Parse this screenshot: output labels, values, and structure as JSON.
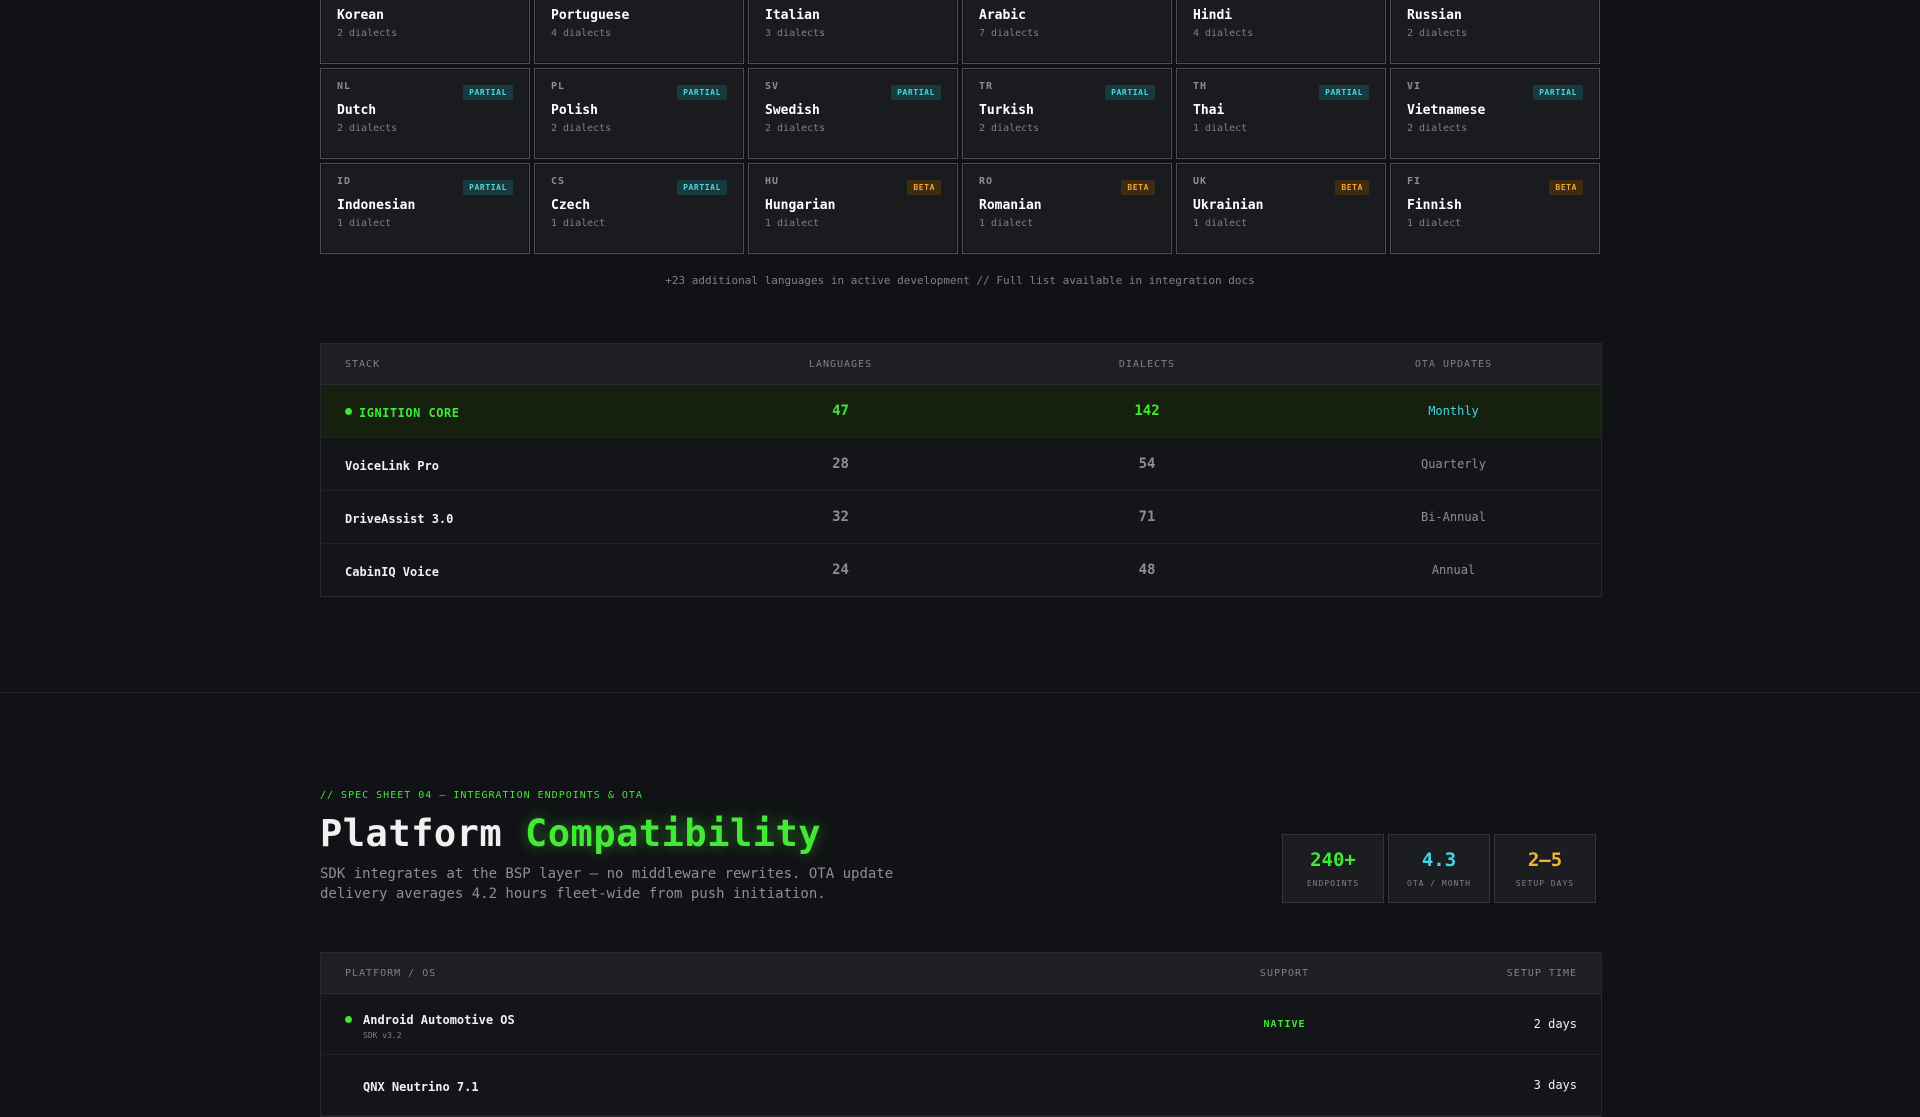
{
  "languages": [
    {
      "code": "",
      "name": "Korean",
      "dialects": "2 dialects",
      "status": "",
      "tier": "full"
    },
    {
      "code": "",
      "name": "Portuguese",
      "dialects": "4 dialects",
      "status": "",
      "tier": "full"
    },
    {
      "code": "",
      "name": "Italian",
      "dialects": "3 dialects",
      "status": "",
      "tier": "full"
    },
    {
      "code": "",
      "name": "Arabic",
      "dialects": "7 dialects",
      "status": "",
      "tier": "full"
    },
    {
      "code": "",
      "name": "Hindi",
      "dialects": "4 dialects",
      "status": "",
      "tier": "full"
    },
    {
      "code": "",
      "name": "Russian",
      "dialects": "2 dialects",
      "status": "",
      "tier": "full"
    },
    {
      "code": "NL",
      "name": "Dutch",
      "dialects": "2 dialects",
      "status": "PARTIAL",
      "tier": "partial"
    },
    {
      "code": "PL",
      "name": "Polish",
      "dialects": "2 dialects",
      "status": "PARTIAL",
      "tier": "partial"
    },
    {
      "code": "SV",
      "name": "Swedish",
      "dialects": "2 dialects",
      "status": "PARTIAL",
      "tier": "partial"
    },
    {
      "code": "TR",
      "name": "Turkish",
      "dialects": "2 dialects",
      "status": "PARTIAL",
      "tier": "partial"
    },
    {
      "code": "TH",
      "name": "Thai",
      "dialects": "1 dialect",
      "status": "PARTIAL",
      "tier": "partial"
    },
    {
      "code": "VI",
      "name": "Vietnamese",
      "dialects": "2 dialects",
      "status": "PARTIAL",
      "tier": "partial"
    },
    {
      "code": "ID",
      "name": "Indonesian",
      "dialects": "1 dialect",
      "status": "PARTIAL",
      "tier": "partial"
    },
    {
      "code": "CS",
      "name": "Czech",
      "dialects": "1 dialect",
      "status": "PARTIAL",
      "tier": "partial"
    },
    {
      "code": "HU",
      "name": "Hungarian",
      "dialects": "1 dialect",
      "status": "BETA",
      "tier": "beta"
    },
    {
      "code": "RO",
      "name": "Romanian",
      "dialects": "1 dialect",
      "status": "BETA",
      "tier": "beta"
    },
    {
      "code": "UK",
      "name": "Ukrainian",
      "dialects": "1 dialect",
      "status": "BETA",
      "tier": "beta"
    },
    {
      "code": "FI",
      "name": "Finnish",
      "dialects": "1 dialect",
      "status": "BETA",
      "tier": "beta"
    }
  ],
  "languages_note": "+23 additional languages in active development // Full list available in integration docs",
  "comparison": {
    "headers": {
      "stack": "STACK",
      "languages": "LANGUAGES",
      "dialects": "DIALECTS",
      "ota": "OTA UPDATES"
    },
    "rows": [
      {
        "stack": "IGNITION CORE",
        "languages": "47",
        "dialects": "142",
        "ota": "Monthly",
        "highlight": true
      },
      {
        "stack": "VoiceLink Pro",
        "languages": "28",
        "dialects": "54",
        "ota": "Quarterly",
        "highlight": false
      },
      {
        "stack": "DriveAssist 3.0",
        "languages": "32",
        "dialects": "71",
        "ota": "Bi-Annual",
        "highlight": false
      },
      {
        "stack": "CabinIQ Voice",
        "languages": "24",
        "dialects": "48",
        "ota": "Annual",
        "highlight": false
      }
    ]
  },
  "platform": {
    "kicker": "// SPEC SHEET 04 — INTEGRATION ENDPOINTS & OTA",
    "title_plain": "Platform",
    "title_accent": "Compatibility",
    "description": "SDK integrates at the BSP layer — no middleware rewrites. OTA update delivery averages 4.2 hours fleet-wide from push initiation.",
    "stats": [
      {
        "value": "240+",
        "label": "ENDPOINTS",
        "color": "#3fe834"
      },
      {
        "value": "4.3",
        "label": "OTA / MONTH",
        "color": "#43d6e0"
      },
      {
        "value": "2–5",
        "label": "SETUP DAYS",
        "color": "#f4b431"
      }
    ],
    "table": {
      "headers": {
        "platform": "PLATFORM / OS",
        "support": "SUPPORT",
        "setup": "SETUP TIME"
      },
      "rows": [
        {
          "name": "Android Automotive OS",
          "sub": "SDK v3.2",
          "support": "NATIVE",
          "setup": "2 days",
          "dot": true
        },
        {
          "name": "QNX Neutrino 7.1",
          "sub": "",
          "support": "",
          "setup": "3 days",
          "dot": false
        }
      ]
    }
  },
  "colors": {
    "accent_green": "#3fe834",
    "accent_cyan": "#43d6e0",
    "accent_amber": "#f4a331",
    "background": "#111215"
  }
}
